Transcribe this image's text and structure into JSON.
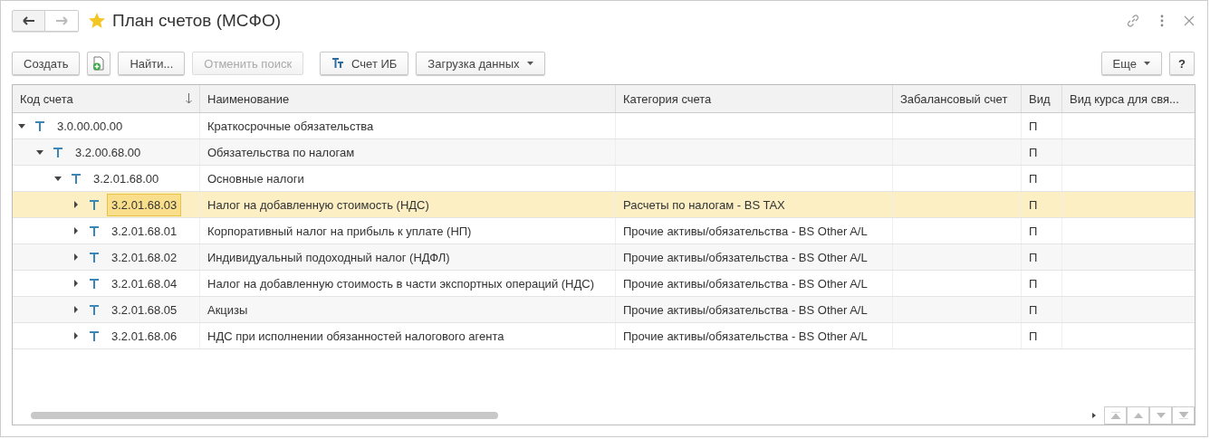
{
  "window": {
    "title": "План счетов (МСФО)",
    "favorite": true
  },
  "toolbar": {
    "buttons": [
      {
        "kind": "text",
        "label": "Создать",
        "disabled": false
      },
      {
        "kind": "icon",
        "disabled": false
      },
      {
        "kind": "text",
        "label": "Найти...",
        "disabled": false
      },
      {
        "kind": "text",
        "label": "Отменить поиск",
        "disabled": true
      },
      {
        "kind": "tt",
        "label": "Счет ИБ",
        "disabled": false
      },
      {
        "kind": "menu",
        "label": "Загрузка данных",
        "disabled": false
      }
    ],
    "right_buttons": [
      {
        "kind": "menu",
        "label": "Еще"
      },
      {
        "kind": "text",
        "label": "?"
      }
    ]
  },
  "table": {
    "columns": [
      {
        "label": "Код счета",
        "sorted": true
      },
      {
        "label": "Наименование",
        "sorted": false
      },
      {
        "label": "Категория счета",
        "sorted": false
      },
      {
        "label": "Забалансовый счет",
        "sorted": false
      },
      {
        "label": "Вид",
        "sorted": false
      },
      {
        "label": "Вид курса для свя...",
        "sorted": false
      }
    ],
    "rows": [
      {
        "code": "3.0.00.00.00",
        "name": "Краткосрочные обязательства",
        "view": "П",
        "expanded": true,
        "selected": false,
        "children": [
          {
            "code": "3.2.00.68.00",
            "name": "Обязательства по налогам",
            "view": "П",
            "expanded": true,
            "selected": false,
            "children": [
              {
                "code": "3.2.01.68.00",
                "name": "Основные налоги",
                "view": "П",
                "expanded": true,
                "selected": false,
                "children": [
                  {
                    "code": "3.2.01.68.03",
                    "name": "Налог на добавленную стоимость (НДС)",
                    "category": "Расчеты по налогам - BS TAX",
                    "view": "П",
                    "expanded": false,
                    "selected": true
                  },
                  {
                    "code": "3.2.01.68.01",
                    "name": "Корпоративный налог на прибыль к уплате (НП)",
                    "category": "Прочие активы/обязательства - BS Other A/L",
                    "view": "П",
                    "expanded": false,
                    "selected": false
                  },
                  {
                    "code": "3.2.01.68.02",
                    "name": "Индивидуальный подоходный налог (НДФЛ)",
                    "category": "Прочие активы/обязательства - BS Other A/L",
                    "view": "П",
                    "expanded": false,
                    "selected": false
                  },
                  {
                    "code": "3.2.01.68.04",
                    "name": "Налог на добавленную стоимость в части экспортных операций (НДС)",
                    "category": "Прочие активы/обязательства - BS Other A/L",
                    "view": "П",
                    "expanded": false,
                    "selected": false
                  },
                  {
                    "code": "3.2.01.68.05",
                    "name": "Акцизы",
                    "category": "Прочие активы/обязательства - BS Other A/L",
                    "view": "П",
                    "expanded": false,
                    "selected": false
                  },
                  {
                    "code": "3.2.01.68.06",
                    "name": "НДС при исполнении обязанностей налогового агента",
                    "category": "Прочие активы/обязательства - BS Other A/L",
                    "view": "П",
                    "expanded": false,
                    "selected": false
                  }
                ]
              }
            ]
          }
        ]
      }
    ]
  }
}
